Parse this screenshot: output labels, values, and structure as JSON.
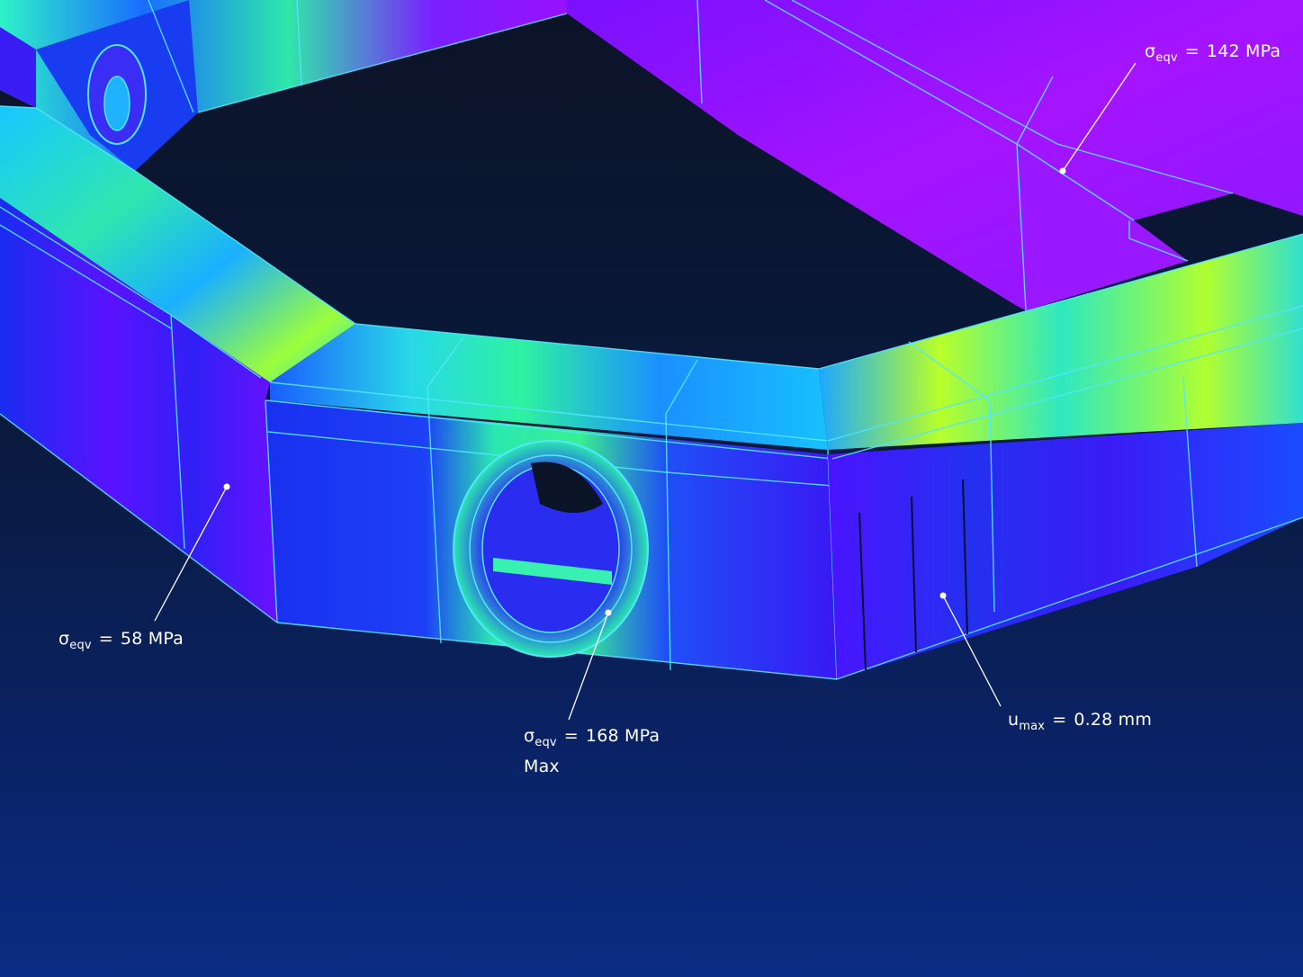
{
  "viewport": {
    "background_top": "#0b1326",
    "background_bottom": "#0b2c84",
    "contour_colors": [
      "#6a00ff",
      "#1a2cf0",
      "#18b5ff",
      "#2ef2c8",
      "#b8ff2a"
    ],
    "mesh_edge_color": "#53e6ff"
  },
  "annotations": {
    "top_right": {
      "symbol": "σ",
      "sub": "eqv",
      "eq": "=",
      "value": "142 MPa"
    },
    "left": {
      "symbol": "σ",
      "sub": "eqv",
      "eq": "=",
      "value": "58 MPa"
    },
    "center": {
      "symbol": "σ",
      "sub": "eqv",
      "eq": "=",
      "value": "168 MPa",
      "note": "Max"
    },
    "right": {
      "symbol": "u",
      "sub": "max",
      "eq": "=",
      "value": "0.28 mm"
    }
  }
}
